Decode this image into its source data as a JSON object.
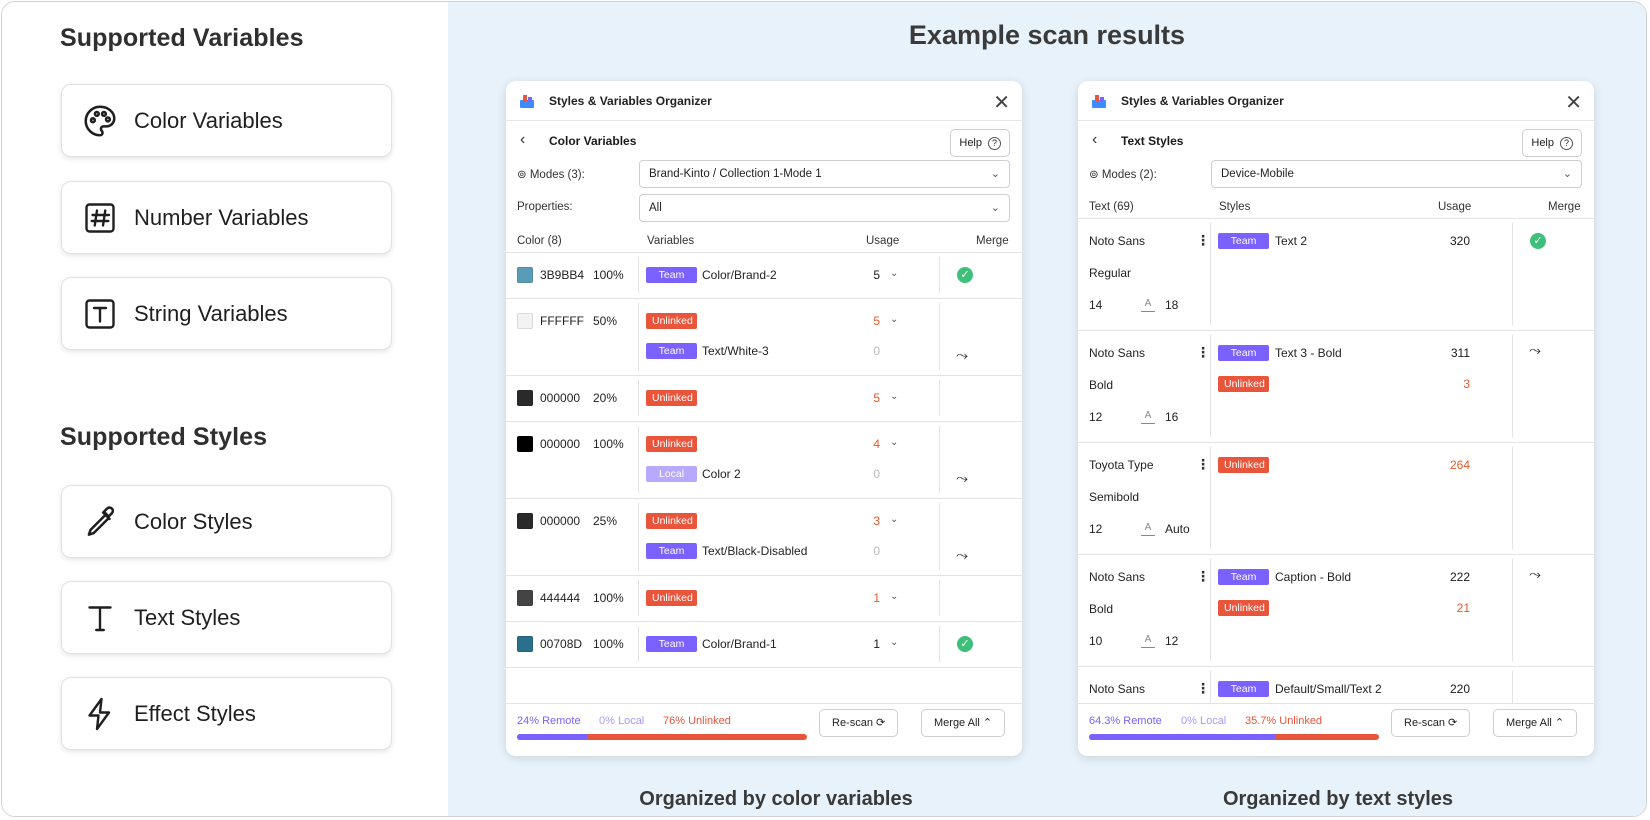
{
  "left": {
    "variables_title": "Supported Variables",
    "variables": [
      {
        "label": "Color Variables",
        "icon": "palette-icon"
      },
      {
        "label": "Number Variables",
        "icon": "hash-icon"
      },
      {
        "label": "String Variables",
        "icon": "text-box-icon"
      }
    ],
    "styles_title": "Supported Styles",
    "styles": [
      {
        "label": "Color Styles",
        "icon": "eyedropper-icon"
      },
      {
        "label": "Text Styles",
        "icon": "text-icon"
      },
      {
        "label": "Effect Styles",
        "icon": "lightning-icon"
      }
    ]
  },
  "main_title": "Example scan results",
  "captions": {
    "color": "Organized by color variables",
    "text": "Organized by text styles"
  },
  "colors": {
    "team": "#7b61ff",
    "unlinked": "#e8553b",
    "local": "#b8a8ff",
    "check": "#3ec07a",
    "background": "#e7f2fa"
  },
  "color_panel": {
    "app_title": "Styles & Variables Organizer",
    "section": "Color Variables",
    "help": "Help",
    "modes_label": "Modes (3):",
    "modes_value": "Brand-Kinto / Collection 1-Mode 1",
    "properties_label": "Properties:",
    "properties_value": "All",
    "headers": {
      "col1": "Color (8)",
      "col2": "Variables",
      "col3": "Usage",
      "col4": "Merge"
    },
    "rows": [
      {
        "hex": "3B9BB4",
        "opacity": "100%",
        "swatch": "#5a9bb7",
        "entries": [
          {
            "tag": "Team",
            "name": "Color/Brand-2",
            "usage": "5"
          }
        ],
        "merge": "check"
      },
      {
        "hex": "FFFFFF",
        "opacity": "50%",
        "swatch": "#f3f3f3",
        "entries": [
          {
            "tag": "Unlinked",
            "name": "",
            "usage": "5"
          },
          {
            "tag": "Team",
            "name": "Text/White-3",
            "usage": "0"
          }
        ],
        "merge": "merge"
      },
      {
        "hex": "000000",
        "opacity": "20%",
        "swatch": "#2a2a2a",
        "entries": [
          {
            "tag": "Unlinked",
            "name": "",
            "usage": "5"
          }
        ],
        "merge": ""
      },
      {
        "hex": "000000",
        "opacity": "100%",
        "swatch": "#000000",
        "entries": [
          {
            "tag": "Unlinked",
            "name": "",
            "usage": "4"
          },
          {
            "tag": "Local",
            "name": "Color 2",
            "usage": "0"
          }
        ],
        "merge": "merge"
      },
      {
        "hex": "000000",
        "opacity": "25%",
        "swatch": "#2a2a2a",
        "entries": [
          {
            "tag": "Unlinked",
            "name": "",
            "usage": "3"
          },
          {
            "tag": "Team",
            "name": "Text/Black-Disabled",
            "usage": "0"
          }
        ],
        "merge": "merge"
      },
      {
        "hex": "444444",
        "opacity": "100%",
        "swatch": "#444444",
        "entries": [
          {
            "tag": "Unlinked",
            "name": "",
            "usage": "1"
          }
        ],
        "merge": ""
      },
      {
        "hex": "00708D",
        "opacity": "100%",
        "swatch": "#2a6f8c",
        "entries": [
          {
            "tag": "Team",
            "name": "Color/Brand-1",
            "usage": "1"
          }
        ],
        "merge": "check"
      }
    ],
    "footer": {
      "remote": "24% Remote",
      "local": "0% Local",
      "unlinked": "76% Unlinked",
      "remote_fraction": 0.24,
      "rescan": "Re-scan",
      "merge_all": "Merge All"
    }
  },
  "text_panel": {
    "app_title": "Styles & Variables Organizer",
    "section": "Text Styles",
    "help": "Help",
    "modes_label": "Modes (2):",
    "modes_value": "Device-Mobile",
    "headers": {
      "col1": "Text (69)",
      "col2": "Styles",
      "col3": "Usage",
      "col4": "Merge"
    },
    "rows": [
      {
        "font": "Noto Sans",
        "weight": "Regular",
        "size": "14",
        "line": "18",
        "entries": [
          {
            "tag": "Team",
            "name": "Text 2",
            "usage": "320"
          }
        ],
        "merge": "check"
      },
      {
        "font": "Noto Sans",
        "weight": "Bold",
        "size": "12",
        "line": "16",
        "entries": [
          {
            "tag": "Team",
            "name": "Text 3 - Bold",
            "usage": "311"
          },
          {
            "tag": "Unlinked",
            "name": "",
            "usage": "3"
          }
        ],
        "merge": "merge"
      },
      {
        "font": "Toyota Type",
        "weight": "Semibold",
        "size": "12",
        "line": "Auto",
        "entries": [
          {
            "tag": "Unlinked",
            "name": "",
            "usage": "264"
          }
        ],
        "merge": ""
      },
      {
        "font": "Noto Sans",
        "weight": "Bold",
        "size": "10",
        "line": "12",
        "entries": [
          {
            "tag": "Team",
            "name": "Caption - Bold",
            "usage": "222"
          },
          {
            "tag": "Unlinked",
            "name": "",
            "usage": "21"
          }
        ],
        "merge": "merge"
      },
      {
        "font": "Noto Sans",
        "weight": "",
        "size": "",
        "line": "",
        "entries": [
          {
            "tag": "Team",
            "name": "Default/Small/Text 2",
            "usage": "220"
          }
        ],
        "merge": ""
      }
    ],
    "footer": {
      "remote": "64.3% Remote",
      "local": "0% Local",
      "unlinked": "35.7% Unlinked",
      "remote_fraction": 0.643,
      "rescan": "Re-scan",
      "merge_all": "Merge All"
    }
  }
}
